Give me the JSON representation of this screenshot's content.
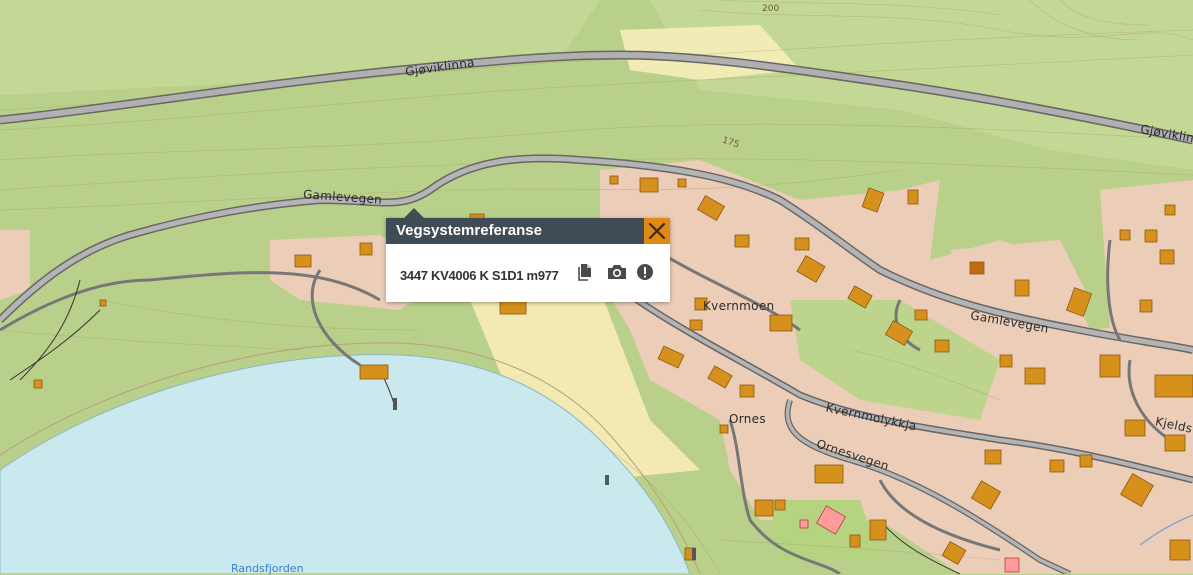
{
  "map": {
    "roads": {
      "gjoviklinna_1": "Gjøviklinna",
      "gjoviklinna_2": "Gjøviklinna",
      "gamlevegen_1": "Gamlevegen",
      "gamlevegen_2": "Gamlevegen",
      "kvernmolykkja": "Kvernmolykkja",
      "ornesvegen": "Ornesvegen",
      "kjeldsl": "Kjelds"
    },
    "places": {
      "kvernmoen": "Kvernmoen",
      "ornes": "Ornes",
      "randsfjorden": "Randsfjorden"
    },
    "contours": {
      "c200": "200",
      "c175": "175"
    }
  },
  "popup": {
    "title": "Vegsystemreferanse",
    "reference": "3447 KV4006 K S1D1 m977",
    "icons": {
      "close": "close-icon",
      "copy": "copy-icon",
      "camera": "camera-icon",
      "report": "alert-icon"
    }
  },
  "colors": {
    "forest": "#b9d08a",
    "residential": "#eccdb8",
    "water": "#c9e9ef",
    "field": "#f3ecb0",
    "road_fill": "#a9a9a9",
    "road_casing": "#6c6c6c",
    "building": "#d6901c",
    "popup_header": "#3f4c55",
    "popup_close": "#e08a13"
  }
}
